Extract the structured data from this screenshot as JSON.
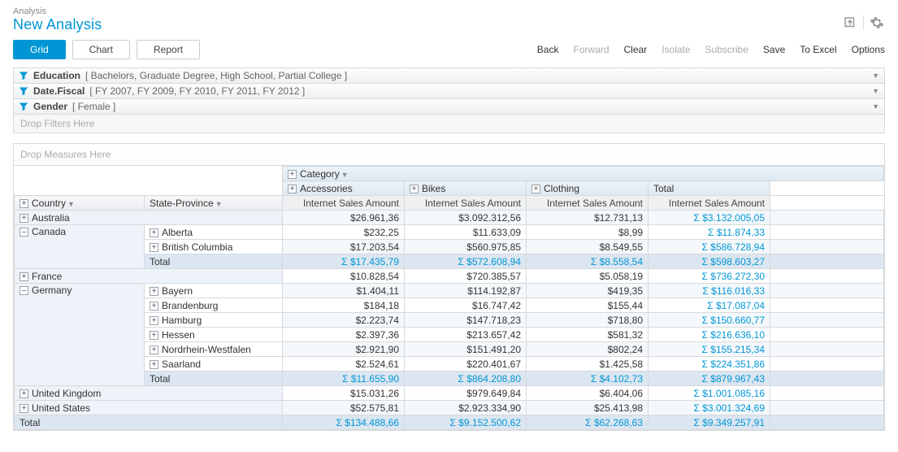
{
  "breadcrumb": "Analysis",
  "title": "New Analysis",
  "viewTabs": {
    "grid": "Grid",
    "chart": "Chart",
    "report": "Report"
  },
  "actions": {
    "back": "Back",
    "forward": "Forward",
    "clear": "Clear",
    "isolate": "Isolate",
    "subscribe": "Subscribe",
    "save": "Save",
    "toExcel": "To Excel",
    "options": "Options"
  },
  "filters": {
    "education": {
      "dim": "Education",
      "sel": "[ Bachelors, Graduate Degree, High School, Partial College ]"
    },
    "dateFiscal": {
      "dim": "Date.Fiscal",
      "sel": "[ FY 2007, FY 2009, FY 2010, FY 2011, FY 2012 ]"
    },
    "gender": {
      "dim": "Gender",
      "sel": "[ Female ]"
    }
  },
  "dropFilters": "Drop Filters Here",
  "dropMeasures": "Drop Measures Here",
  "colHeaders": {
    "category": "Category",
    "accessories": "Accessories",
    "bikes": "Bikes",
    "clothing": "Clothing",
    "total": "Total",
    "measure": "Internet Sales Amount"
  },
  "rowHeaders": {
    "country": "Country",
    "state": "State-Province",
    "total": "Total"
  },
  "rows": {
    "australia": {
      "label": "Australia",
      "acc": "$26.961,36",
      "bik": "$3.092.312,56",
      "clo": "$12.731,13",
      "tot": "$3.132.005,05"
    },
    "canada": {
      "label": "Canada"
    },
    "alberta": {
      "label": "Alberta",
      "acc": "$232,25",
      "bik": "$11.633,09",
      "clo": "$8,99",
      "tot": "$11.874,33"
    },
    "bc": {
      "label": "British Columbia",
      "acc": "$17.203,54",
      "bik": "$560.975,85",
      "clo": "$8.549,55",
      "tot": "$586.728,94"
    },
    "canadaTotal": {
      "label": "Total",
      "acc": "$17.435,79",
      "bik": "$572.608,94",
      "clo": "$8.558,54",
      "tot": "$598.603,27"
    },
    "france": {
      "label": "France",
      "acc": "$10.828,54",
      "bik": "$720.385,57",
      "clo": "$5.058,19",
      "tot": "$736.272,30"
    },
    "germany": {
      "label": "Germany"
    },
    "bayern": {
      "label": "Bayern",
      "acc": "$1.404,11",
      "bik": "$114.192,87",
      "clo": "$419,35",
      "tot": "$116.016,33"
    },
    "brandenburg": {
      "label": "Brandenburg",
      "acc": "$184,18",
      "bik": "$16.747,42",
      "clo": "$155,44",
      "tot": "$17.087,04"
    },
    "hamburg": {
      "label": "Hamburg",
      "acc": "$2.223,74",
      "bik": "$147.718,23",
      "clo": "$718,80",
      "tot": "$150.660,77"
    },
    "hessen": {
      "label": "Hessen",
      "acc": "$2.397,36",
      "bik": "$213.657,42",
      "clo": "$581,32",
      "tot": "$216.636,10"
    },
    "nrw": {
      "label": "Nordrhein-Westfalen",
      "acc": "$2.921,90",
      "bik": "$151.491,20",
      "clo": "$802,24",
      "tot": "$155.215,34"
    },
    "saarland": {
      "label": "Saarland",
      "acc": "$2.524,61",
      "bik": "$220.401,67",
      "clo": "$1.425,58",
      "tot": "$224.351,86"
    },
    "germanyTotal": {
      "label": "Total",
      "acc": "$11.655,90",
      "bik": "$864.208,80",
      "clo": "$4.102,73",
      "tot": "$879.967,43"
    },
    "uk": {
      "label": "United Kingdom",
      "acc": "$15.031,26",
      "bik": "$979.649,84",
      "clo": "$6.404,06",
      "tot": "$1.001.085,16"
    },
    "us": {
      "label": "United States",
      "acc": "$52.575,81",
      "bik": "$2.923.334,90",
      "clo": "$25.413,98",
      "tot": "$3.001.324,69"
    },
    "grand": {
      "label": "Total",
      "acc": "$134.488,66",
      "bik": "$9.152.500,62",
      "clo": "$62.268,63",
      "tot": "$9.349.257,91"
    }
  }
}
